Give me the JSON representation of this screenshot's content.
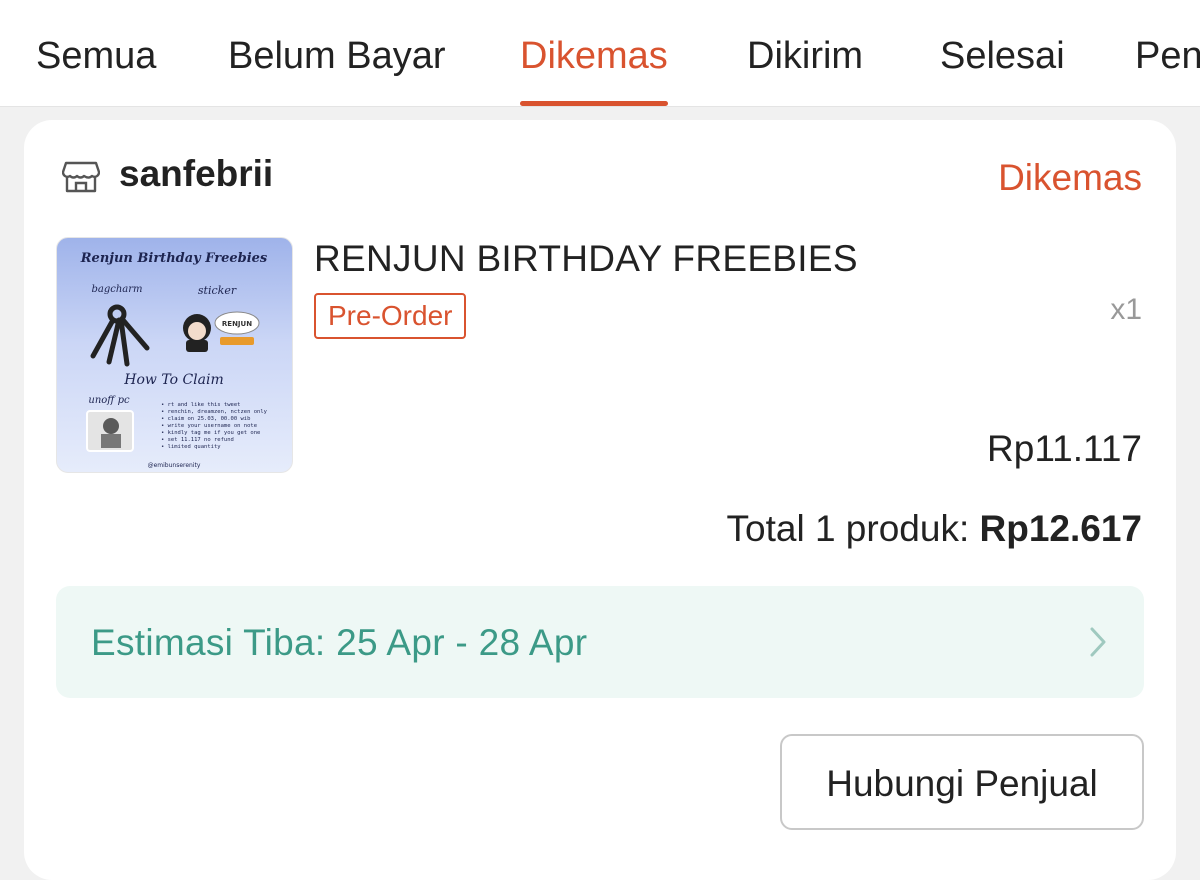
{
  "tabs": [
    {
      "label": "Semua"
    },
    {
      "label": "Belum Bayar"
    },
    {
      "label": "Dikemas"
    },
    {
      "label": "Dikirim"
    },
    {
      "label": "Selesai"
    },
    {
      "label": "Pen"
    }
  ],
  "active_tab": "Dikemas",
  "order": {
    "shop_name": "sanfebrii",
    "status": "Dikemas",
    "product": {
      "name": "RENJUN BIRTHDAY FREEBIES",
      "badge": "Pre-Order",
      "quantity": "x1",
      "price": "Rp11.117",
      "image": {
        "title": "Renjun Birthday Freebies",
        "labels": [
          "bagcharm",
          "sticker",
          "How To Claim",
          "unoff pc",
          "RENJUN",
          "@emibunserenity"
        ],
        "claim_lines": [
          "• rt and like this tweet",
          "• renchin, dreamzen, nctzen only",
          "• claim on 25.03, 00.00 wib",
          "• write your username on note",
          "• kindly tag me if you get one",
          "• set 11.117 no refund",
          "• limited quantity"
        ]
      }
    },
    "total_label": "Total 1 produk: ",
    "total_value": "Rp12.617",
    "estimate": "Estimasi Tiba: 25 Apr - 28 Apr",
    "contact_button": "Hubungi Penjual"
  },
  "colors": {
    "accent": "#d9532f",
    "estimate_text": "#3c9a87",
    "estimate_bg": "#eef8f5"
  },
  "icons": [
    "shop-icon",
    "chevron-right-icon"
  ]
}
